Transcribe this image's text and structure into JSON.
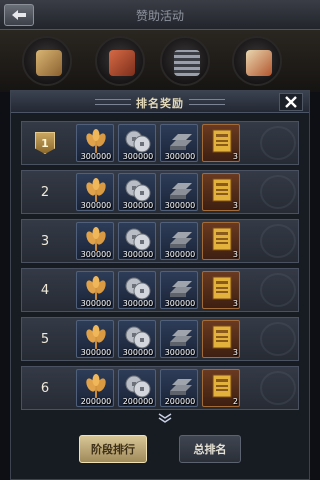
{
  "top_bar": {
    "title": "赞助活动"
  },
  "events": [
    {
      "name": "event-scroll",
      "color": "#b8914c"
    },
    {
      "name": "event-chest",
      "color": "#c0553a"
    },
    {
      "name": "event-calendar",
      "color": "#8a8f98"
    },
    {
      "name": "event-treasure",
      "color": "#c46a3e"
    }
  ],
  "panel": {
    "title": "排名奖励",
    "close_icon": "close-icon"
  },
  "rewards": [
    {
      "rank": "1",
      "wheat": "300000",
      "coins": "300000",
      "iron": "300000",
      "book": "3",
      "badge": true
    },
    {
      "rank": "2",
      "wheat": "300000",
      "coins": "300000",
      "iron": "300000",
      "book": "3",
      "badge": false
    },
    {
      "rank": "3",
      "wheat": "300000",
      "coins": "300000",
      "iron": "300000",
      "book": "3",
      "badge": false
    },
    {
      "rank": "4",
      "wheat": "300000",
      "coins": "300000",
      "iron": "300000",
      "book": "3",
      "badge": false
    },
    {
      "rank": "5",
      "wheat": "300000",
      "coins": "300000",
      "iron": "300000",
      "book": "3",
      "badge": false
    },
    {
      "rank": "6",
      "wheat": "200000",
      "coins": "200000",
      "iron": "200000",
      "book": "2",
      "badge": false
    }
  ],
  "buttons": {
    "stage_rank": "阶段排行",
    "total_rank": "总排名"
  },
  "icons": {
    "back": "back-arrow-icon",
    "wheat": "wheat-icon",
    "coins": "coins-icon",
    "iron": "iron-ingot-icon",
    "book": "book-icon",
    "more": "chevron-down-icon"
  },
  "colors": {
    "stage_button": "#d8c697",
    "total_button": "#404652",
    "rank_badge": "#c9a560"
  }
}
